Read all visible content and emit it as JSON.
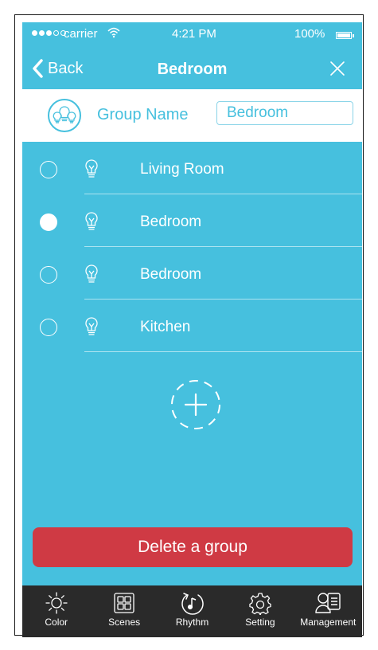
{
  "status_bar": {
    "carrier": "carrier",
    "time": "4:21 PM",
    "battery_percent": "100%",
    "signal_bars": 3,
    "signal_total": 5,
    "battery_level": 1.0
  },
  "nav": {
    "back_label": "Back",
    "title": "Bedroom"
  },
  "group": {
    "label": "Group Name",
    "name_value": "Bedroom"
  },
  "lights": [
    {
      "label": "Living Room",
      "selected": false
    },
    {
      "label": "Bedroom",
      "selected": true
    },
    {
      "label": "Bedroom",
      "selected": false
    },
    {
      "label": "Kitchen",
      "selected": false
    }
  ],
  "delete_label": "Delete a group",
  "tabs": [
    {
      "label": "Color",
      "icon": "sun-icon"
    },
    {
      "label": "Scenes",
      "icon": "grid-icon"
    },
    {
      "label": "Rhythm",
      "icon": "music-icon"
    },
    {
      "label": "Setting",
      "icon": "gear-icon"
    },
    {
      "label": "Management",
      "icon": "user-list-icon"
    }
  ],
  "colors": {
    "primary": "#46c0de",
    "danger": "#cf3a44",
    "tabbar": "#2a2a2a"
  }
}
